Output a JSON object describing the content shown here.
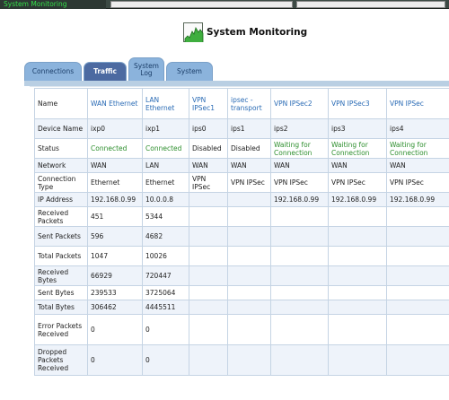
{
  "window": {
    "title": "System Monitoring"
  },
  "page": {
    "title": "System Monitoring"
  },
  "tabs": [
    {
      "label": "Connections"
    },
    {
      "label": "Traffic",
      "active": true
    },
    {
      "label": "System Log"
    },
    {
      "label": "System"
    }
  ],
  "table": {
    "header": [
      "Name",
      "WAN Ethernet",
      "LAN Ethernet",
      "VPN IPSec1",
      "ipsec - transport",
      "VPN IPSec2",
      "VPN IPSec3",
      "VPN IPSec"
    ],
    "rows": [
      [
        "Device Name",
        "ixp0",
        "ixp1",
        "ips0",
        "ips1",
        "ips2",
        "ips3",
        "ips4"
      ],
      [
        "Status",
        "Connected",
        "Connected",
        "Disabled",
        "Disabled",
        "Waiting for Connection",
        "Waiting for Connection",
        "Waiting for Connection"
      ],
      [
        "Network",
        "WAN",
        "LAN",
        "WAN",
        "WAN",
        "WAN",
        "WAN",
        "WAN"
      ],
      [
        "Connection Type",
        "Ethernet",
        "Ethernet",
        "VPN IPSec",
        "VPN IPSec",
        "VPN IPSec",
        "VPN IPSec",
        "VPN IPSec"
      ],
      [
        "IP Address",
        "192.168.0.99",
        "10.0.0.8",
        "",
        "",
        "192.168.0.99",
        "192.168.0.99",
        "192.168.0.99"
      ],
      [
        "Received Packets",
        "451",
        "5344",
        "",
        "",
        "",
        "",
        ""
      ],
      [
        "Sent Packets",
        "596",
        "4682",
        "",
        "",
        "",
        "",
        ""
      ],
      [
        "Total Packets",
        "1047",
        "10026",
        "",
        "",
        "",
        "",
        ""
      ],
      [
        "Received Bytes",
        "66929",
        "720447",
        "",
        "",
        "",
        "",
        ""
      ],
      [
        "Sent Bytes",
        "239533",
        "3725064",
        "",
        "",
        "",
        "",
        ""
      ],
      [
        "Total Bytes",
        "306462",
        "4445511",
        "",
        "",
        "",
        "",
        ""
      ],
      [
        "Error Packets Received",
        "0",
        "0",
        "",
        "",
        "",
        "",
        ""
      ],
      [
        "Dropped Packets Received",
        "0",
        "0",
        "",
        "",
        "",
        "",
        ""
      ]
    ]
  },
  "colors": {
    "header_text": "#2a6bb5",
    "connected_text": "#2e8f2e",
    "active_tab": "#4c6aa1",
    "inactive_tab": "#8bb3dc",
    "row_alt": "#eef3fa",
    "titlebar_text": "#35e04a"
  },
  "icons": {
    "page_icon": "chart-icon"
  }
}
